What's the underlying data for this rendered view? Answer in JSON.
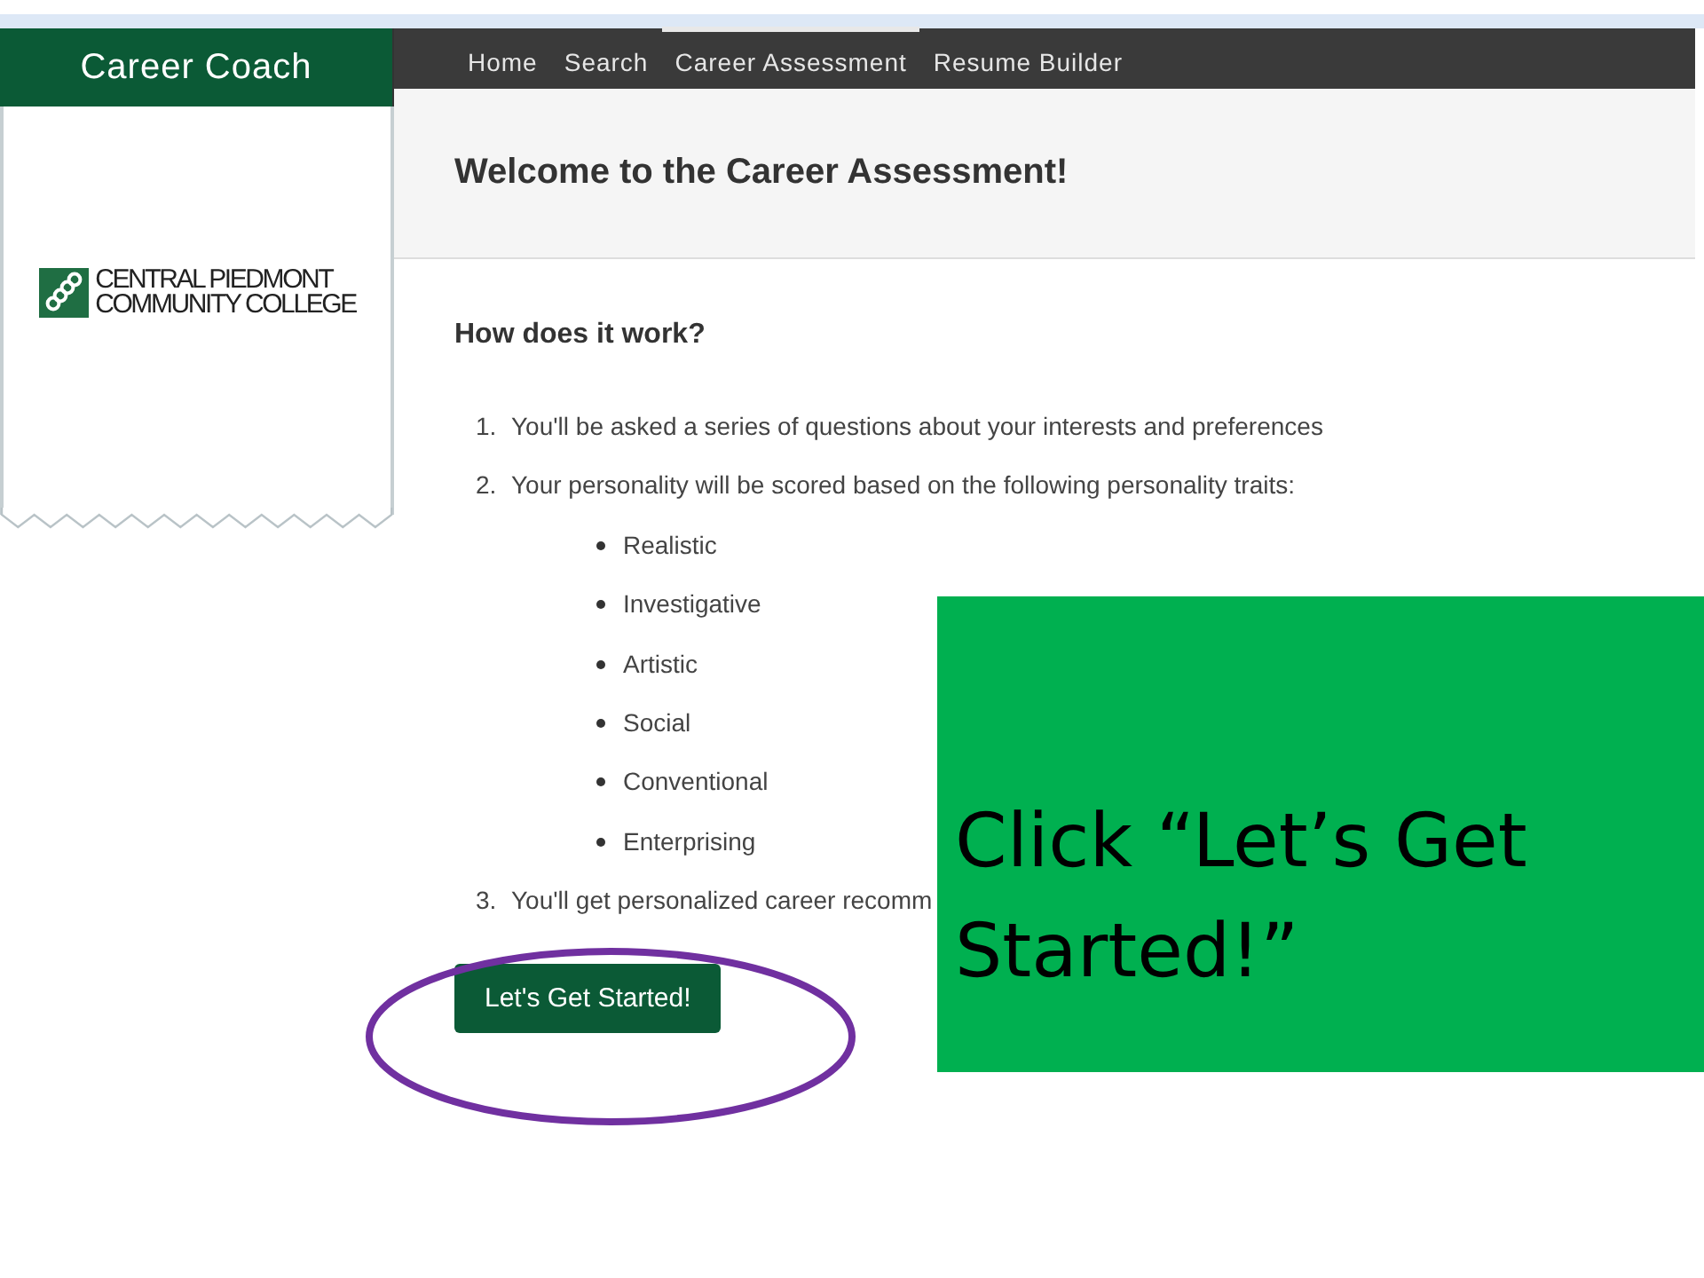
{
  "brand": {
    "title": "Career Coach",
    "logo_lines": [
      "CENTRAL PIEDMONT",
      "COMMUNITY COLLEGE"
    ]
  },
  "nav": [
    {
      "label": "Home",
      "selected": false
    },
    {
      "label": "Search",
      "selected": false
    },
    {
      "label": "Career Assessment",
      "selected": true
    },
    {
      "label": "Resume Builder",
      "selected": false
    }
  ],
  "page_title": "Welcome to the Career Assessment!",
  "section_heading": "How does it work?",
  "steps": [
    {
      "number": "1.",
      "text": "You'll be asked a series of questions about your interests and preferences"
    },
    {
      "number": "2.",
      "text": "Your personality will be scored based on the following personality traits:",
      "traits": [
        "Realistic",
        "Investigative",
        "Artistic",
        "Social",
        "Conventional",
        "Enterprising"
      ]
    },
    {
      "number": "3.",
      "text": "You'll get personalized career recomm"
    }
  ],
  "start_button": "Let's Get Started!",
  "callout": {
    "text": "Click “Let’s Get Started!”"
  }
}
